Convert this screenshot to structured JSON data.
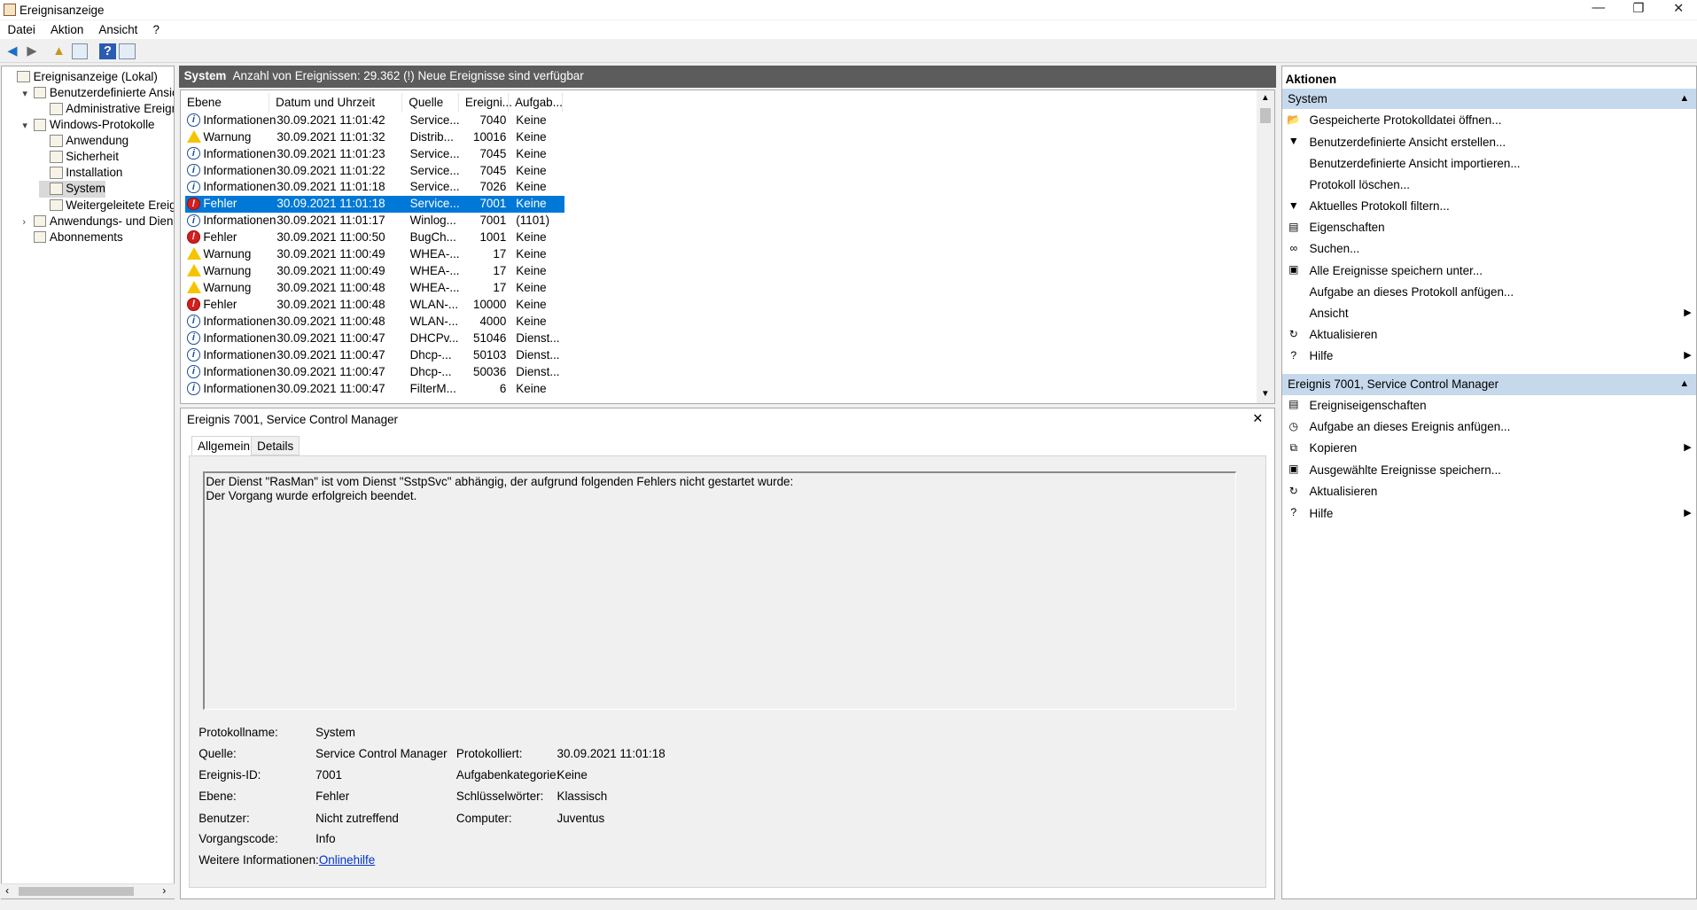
{
  "window": {
    "title": "Ereignisanzeige",
    "minimize": "—",
    "restore": "❐",
    "close": "✕"
  },
  "menu": [
    "Datei",
    "Aktion",
    "Ansicht",
    "?"
  ],
  "tree": [
    {
      "label": "Ereignisanzeige (Lokal)",
      "twisty": "",
      "icon": "event-viewer-icon"
    },
    {
      "label": "Benutzerdefinierte Ansichten",
      "twisty": "▾",
      "icon": "folder-icon"
    },
    {
      "label": "Administrative Ereignisse",
      "twisty": "",
      "icon": "filter-icon"
    },
    {
      "label": "Windows-Protokolle",
      "twisty": "▾",
      "icon": "folder-icon"
    },
    {
      "label": "Anwendung",
      "twisty": "",
      "icon": "log-icon"
    },
    {
      "label": "Sicherheit",
      "twisty": "",
      "icon": "log-icon"
    },
    {
      "label": "Installation",
      "twisty": "",
      "icon": "log-icon"
    },
    {
      "label": "System",
      "twisty": "",
      "icon": "log-icon"
    },
    {
      "label": "Weitergeleitete Ereignisse",
      "twisty": "",
      "icon": "log-icon"
    },
    {
      "label": "Anwendungs- und Dienstprotokolle",
      "twisty": "›",
      "icon": "folder-icon"
    },
    {
      "label": "Abonnements",
      "twisty": "",
      "icon": "folder-icon"
    }
  ],
  "header": {
    "log": "System",
    "summary": "Anzahl von Ereignissen: 29.362 (!) Neue Ereignisse sind verfügbar"
  },
  "columns": [
    "Ebene",
    "Datum und Uhrzeit",
    "Quelle",
    "Ereigni...",
    "Aufgab..."
  ],
  "events": [
    {
      "level": "Informationen",
      "type": "info",
      "date": "30.09.2021 11:01:42",
      "source": "Service...",
      "id": "7040",
      "task": "Keine"
    },
    {
      "level": "Warnung",
      "type": "warn",
      "date": "30.09.2021 11:01:32",
      "source": "Distrib...",
      "id": "10016",
      "task": "Keine"
    },
    {
      "level": "Informationen",
      "type": "info",
      "date": "30.09.2021 11:01:23",
      "source": "Service...",
      "id": "7045",
      "task": "Keine"
    },
    {
      "level": "Informationen",
      "type": "info",
      "date": "30.09.2021 11:01:22",
      "source": "Service...",
      "id": "7045",
      "task": "Keine"
    },
    {
      "level": "Informationen",
      "type": "info",
      "date": "30.09.2021 11:01:18",
      "source": "Service...",
      "id": "7026",
      "task": "Keine"
    },
    {
      "level": "Fehler",
      "type": "err",
      "date": "30.09.2021 11:01:18",
      "source": "Service...",
      "id": "7001",
      "task": "Keine",
      "selected": true
    },
    {
      "level": "Informationen",
      "type": "info",
      "date": "30.09.2021 11:01:17",
      "source": "Winlog...",
      "id": "7001",
      "task": "(1101)"
    },
    {
      "level": "Fehler",
      "type": "err",
      "date": "30.09.2021 11:00:50",
      "source": "BugCh...",
      "id": "1001",
      "task": "Keine"
    },
    {
      "level": "Warnung",
      "type": "warn",
      "date": "30.09.2021 11:00:49",
      "source": "WHEA-...",
      "id": "17",
      "task": "Keine"
    },
    {
      "level": "Warnung",
      "type": "warn",
      "date": "30.09.2021 11:00:49",
      "source": "WHEA-...",
      "id": "17",
      "task": "Keine"
    },
    {
      "level": "Warnung",
      "type": "warn",
      "date": "30.09.2021 11:00:48",
      "source": "WHEA-...",
      "id": "17",
      "task": "Keine"
    },
    {
      "level": "Fehler",
      "type": "err",
      "date": "30.09.2021 11:00:48",
      "source": "WLAN-...",
      "id": "10000",
      "task": "Keine"
    },
    {
      "level": "Informationen",
      "type": "info",
      "date": "30.09.2021 11:00:48",
      "source": "WLAN-...",
      "id": "4000",
      "task": "Keine"
    },
    {
      "level": "Informationen",
      "type": "info",
      "date": "30.09.2021 11:00:47",
      "source": "DHCPv...",
      "id": "51046",
      "task": "Dienst..."
    },
    {
      "level": "Informationen",
      "type": "info",
      "date": "30.09.2021 11:00:47",
      "source": "Dhcp-...",
      "id": "50103",
      "task": "Dienst..."
    },
    {
      "level": "Informationen",
      "type": "info",
      "date": "30.09.2021 11:00:47",
      "source": "Dhcp-...",
      "id": "50036",
      "task": "Dienst..."
    },
    {
      "level": "Informationen",
      "type": "info",
      "date": "30.09.2021 11:00:47",
      "source": "FilterM...",
      "id": "6",
      "task": "Keine"
    }
  ],
  "detail": {
    "title": "Ereignis 7001, Service Control Manager",
    "close": "✕",
    "tabs": [
      "Allgemein",
      "Details"
    ],
    "message_line1": "Der Dienst \"RasMan\" ist vom Dienst \"SstpSvc\" abhängig, der aufgrund folgenden Fehlers nicht gestartet wurde:",
    "message_line2": "Der Vorgang wurde erfolgreich beendet.",
    "labels": {
      "logname": "Protokollname:",
      "source": "Quelle:",
      "eventid": "Ereignis-ID:",
      "level": "Ebene:",
      "user": "Benutzer:",
      "opcode": "Vorgangscode:",
      "moreinfo": "Weitere Informationen:",
      "logged": "Protokolliert:",
      "category": "Aufgabenkategorie:",
      "keywords": "Schlüsselwörter:",
      "computer": "Computer:"
    },
    "values": {
      "logname": "System",
      "source": "Service Control Manager",
      "eventid": "7001",
      "level": "Fehler",
      "user": "Nicht zutreffend",
      "opcode": "Info",
      "moreinfo": "Onlinehilfe",
      "logged": "30.09.2021 11:01:18",
      "category": "Keine",
      "keywords": "Klassisch",
      "computer": "Juventus"
    }
  },
  "actions": {
    "title": "Aktionen",
    "group1": {
      "label": "System",
      "items": [
        {
          "label": "Gespeicherte Protokolldatei öffnen...",
          "icon": "open-folder-icon",
          "glyph": "📂",
          "sub": ""
        },
        {
          "label": "Benutzerdefinierte Ansicht erstellen...",
          "icon": "filter-icon",
          "glyph": "▼",
          "sub": ""
        },
        {
          "label": "Benutzerdefinierte Ansicht importieren...",
          "icon": "",
          "glyph": "",
          "sub": ""
        },
        {
          "label": "Protokoll löschen...",
          "icon": "",
          "glyph": "",
          "sub": ""
        },
        {
          "label": "Aktuelles Protokoll filtern...",
          "icon": "filter-icon",
          "glyph": "▼",
          "sub": ""
        },
        {
          "label": "Eigenschaften",
          "icon": "properties-icon",
          "glyph": "▤",
          "sub": ""
        },
        {
          "label": "Suchen...",
          "icon": "binoculars-icon",
          "glyph": "∞",
          "sub": ""
        },
        {
          "label": "Alle Ereignisse speichern unter...",
          "icon": "save-icon",
          "glyph": "▣",
          "sub": ""
        },
        {
          "label": "Aufgabe an dieses Protokoll anfügen...",
          "icon": "",
          "glyph": "",
          "sub": ""
        },
        {
          "label": "Ansicht",
          "icon": "",
          "glyph": "",
          "sub": "▶"
        },
        {
          "label": "Aktualisieren",
          "icon": "refresh-icon",
          "glyph": "↻",
          "sub": ""
        },
        {
          "label": "Hilfe",
          "icon": "help-icon",
          "glyph": "?",
          "sub": "▶"
        }
      ]
    },
    "group2": {
      "label": "Ereignis 7001, Service Control Manager",
      "items": [
        {
          "label": "Ereigniseigenschaften",
          "icon": "properties-icon",
          "glyph": "▤",
          "sub": ""
        },
        {
          "label": "Aufgabe an dieses Ereignis anfügen...",
          "icon": "task-icon",
          "glyph": "◷",
          "sub": ""
        },
        {
          "label": "Kopieren",
          "icon": "copy-icon",
          "glyph": "⧉",
          "sub": "▶"
        },
        {
          "label": "Ausgewählte Ereignisse speichern...",
          "icon": "save-icon",
          "glyph": "▣",
          "sub": ""
        },
        {
          "label": "Aktualisieren",
          "icon": "refresh-icon",
          "glyph": "↻",
          "sub": ""
        },
        {
          "label": "Hilfe",
          "icon": "help-icon",
          "glyph": "?",
          "sub": "▶"
        }
      ]
    }
  },
  "colors": {
    "selection": "#0078d7",
    "header_bar": "#5c5c5c",
    "action_group": "#c6d9ec",
    "link": "#0033cc"
  }
}
